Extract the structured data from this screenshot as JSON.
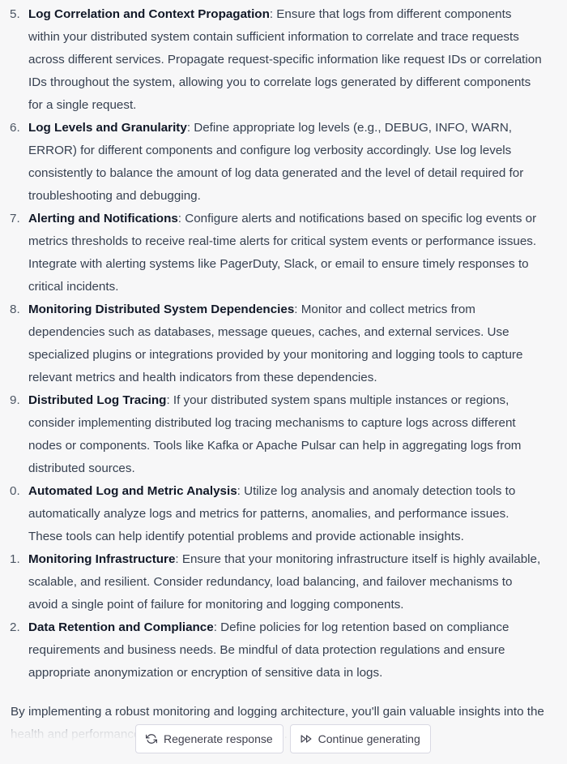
{
  "list": {
    "items": [
      {
        "num": "5.",
        "title": "Log Correlation and Context Propagation",
        "body": ": Ensure that logs from different components within your distributed system contain sufficient information to correlate and trace requests across different services. Propagate request-specific information like request IDs or correlation IDs throughout the system, allowing you to correlate logs generated by different components for a single request."
      },
      {
        "num": "6.",
        "title": "Log Levels and Granularity",
        "body": ": Define appropriate log levels (e.g., DEBUG, INFO, WARN, ERROR) for different components and configure log verbosity accordingly. Use log levels consistently to balance the amount of log data generated and the level of detail required for troubleshooting and debugging."
      },
      {
        "num": "7.",
        "title": "Alerting and Notifications",
        "body": ": Configure alerts and notifications based on specific log events or metrics thresholds to receive real-time alerts for critical system events or performance issues. Integrate with alerting systems like PagerDuty, Slack, or email to ensure timely responses to critical incidents."
      },
      {
        "num": "8.",
        "title": "Monitoring Distributed System Dependencies",
        "body": ": Monitor and collect metrics from dependencies such as databases, message queues, caches, and external services. Use specialized plugins or integrations provided by your monitoring and logging tools to capture relevant metrics and health indicators from these dependencies."
      },
      {
        "num": "9.",
        "title": "Distributed Log Tracing",
        "body": ": If your distributed system spans multiple instances or regions, consider implementing distributed log tracing mechanisms to capture logs across different nodes or components. Tools like Kafka or Apache Pulsar can help in aggregating logs from distributed sources."
      },
      {
        "num": "0.",
        "title": "Automated Log and Metric Analysis",
        "body": ": Utilize log analysis and anomaly detection tools to automatically analyze logs and metrics for patterns, anomalies, and performance issues. These tools can help identify potential problems and provide actionable insights."
      },
      {
        "num": "1.",
        "title": "Monitoring Infrastructure",
        "body": ": Ensure that your monitoring infrastructure itself is highly available, scalable, and resilient. Consider redundancy, load balancing, and failover mechanisms to avoid a single point of failure for monitoring and logging components."
      },
      {
        "num": "2.",
        "title": "Data Retention and Compliance",
        "body": ": Define policies for log retention based on compliance requirements and business needs. Be mindful of data protection regulations and ensure appropriate anonymization or encryption of sensitive data in logs."
      }
    ]
  },
  "conclusion": "By implementing a robust monitoring and logging architecture, you'll gain valuable insights into the health and performance of your distributed system.",
  "actions": {
    "regenerate_label": "Regenerate response",
    "regenerate_icon": "refresh-icon",
    "continue_label": "Continue generating",
    "continue_icon": "fast-forward-icon"
  },
  "colors": {
    "background": "#f7f7f8",
    "text": "#374151",
    "heading": "#111827",
    "button_border": "#d9d9e3"
  }
}
